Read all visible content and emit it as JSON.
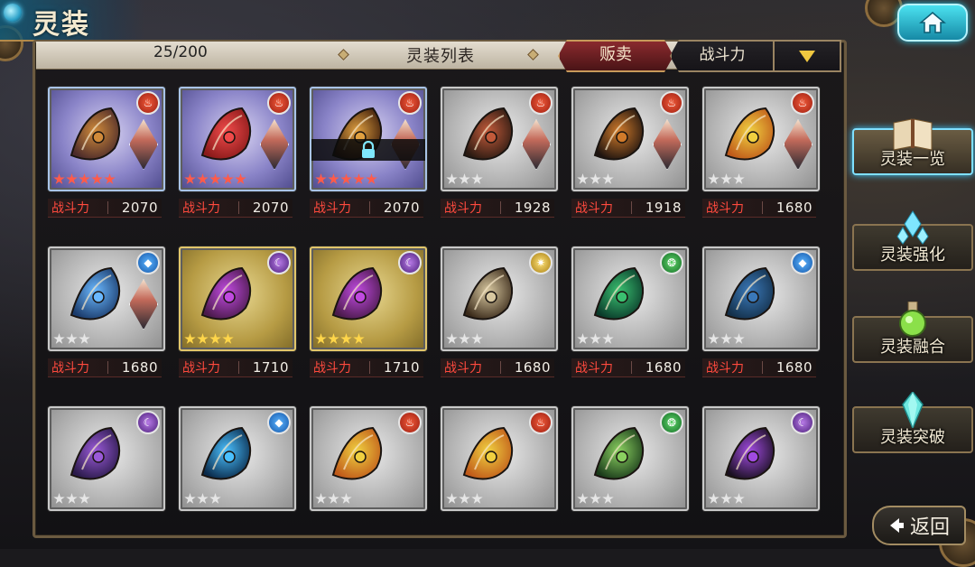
{
  "header": {
    "title": "灵装"
  },
  "toolbar": {
    "count": "25/200",
    "list_title": "灵装列表",
    "sell_label": "贩卖",
    "sort_label": "战斗力"
  },
  "power_label": "战斗力",
  "cards": [
    {
      "element": "fire",
      "stars": 5,
      "star_color": "red",
      "power": "2070",
      "frame": "purple",
      "portrait": true,
      "locked": false
    },
    {
      "element": "fire",
      "stars": 5,
      "star_color": "red",
      "power": "2070",
      "frame": "purple",
      "portrait": true,
      "locked": false
    },
    {
      "element": "fire",
      "stars": 5,
      "star_color": "red",
      "power": "2070",
      "frame": "purple",
      "portrait": true,
      "locked": true
    },
    {
      "element": "fire",
      "stars": 3,
      "star_color": "silver",
      "power": "1928",
      "frame": "silver",
      "portrait": true,
      "locked": false
    },
    {
      "element": "fire",
      "stars": 3,
      "star_color": "silver",
      "power": "1918",
      "frame": "silver",
      "portrait": true,
      "locked": false
    },
    {
      "element": "fire",
      "stars": 3,
      "star_color": "silver",
      "power": "1680",
      "frame": "silver",
      "portrait": true,
      "locked": false
    },
    {
      "element": "water",
      "stars": 3,
      "star_color": "silver",
      "power": "1680",
      "frame": "silver",
      "portrait": true,
      "locked": false
    },
    {
      "element": "dark",
      "stars": 4,
      "star_color": "gold",
      "power": "1710",
      "frame": "gold",
      "portrait": false,
      "locked": false
    },
    {
      "element": "dark",
      "stars": 4,
      "star_color": "gold",
      "power": "1710",
      "frame": "gold",
      "portrait": false,
      "locked": false
    },
    {
      "element": "light",
      "stars": 3,
      "star_color": "silver",
      "power": "1680",
      "frame": "silver",
      "portrait": false,
      "locked": false
    },
    {
      "element": "wind",
      "stars": 3,
      "star_color": "silver",
      "power": "1680",
      "frame": "silver",
      "portrait": false,
      "locked": false
    },
    {
      "element": "water",
      "stars": 3,
      "star_color": "silver",
      "power": "1680",
      "frame": "silver",
      "portrait": false,
      "locked": false
    },
    {
      "element": "dark",
      "stars": 3,
      "star_color": "silver",
      "power": "",
      "frame": "silver",
      "portrait": false,
      "locked": false
    },
    {
      "element": "water",
      "stars": 3,
      "star_color": "silver",
      "power": "",
      "frame": "silver",
      "portrait": false,
      "locked": false
    },
    {
      "element": "fire",
      "stars": 3,
      "star_color": "silver",
      "power": "",
      "frame": "silver",
      "portrait": false,
      "locked": false
    },
    {
      "element": "fire",
      "stars": 3,
      "star_color": "silver",
      "power": "",
      "frame": "silver",
      "portrait": false,
      "locked": false
    },
    {
      "element": "wind",
      "stars": 3,
      "star_color": "silver",
      "power": "",
      "frame": "silver",
      "portrait": false,
      "locked": false
    },
    {
      "element": "dark",
      "stars": 3,
      "star_color": "silver",
      "power": "",
      "frame": "silver",
      "portrait": false,
      "locked": false
    }
  ],
  "side_menu": {
    "item0": "灵装一览",
    "item1": "灵装强化",
    "item2": "灵装融合",
    "item3": "灵装突破"
  },
  "back_label": "返回",
  "colors": {
    "power_red": "#ff4a3e",
    "accent_cyan": "#3cc8ff",
    "sell_red": "#8a2a2e",
    "gold": "#f0c840"
  }
}
